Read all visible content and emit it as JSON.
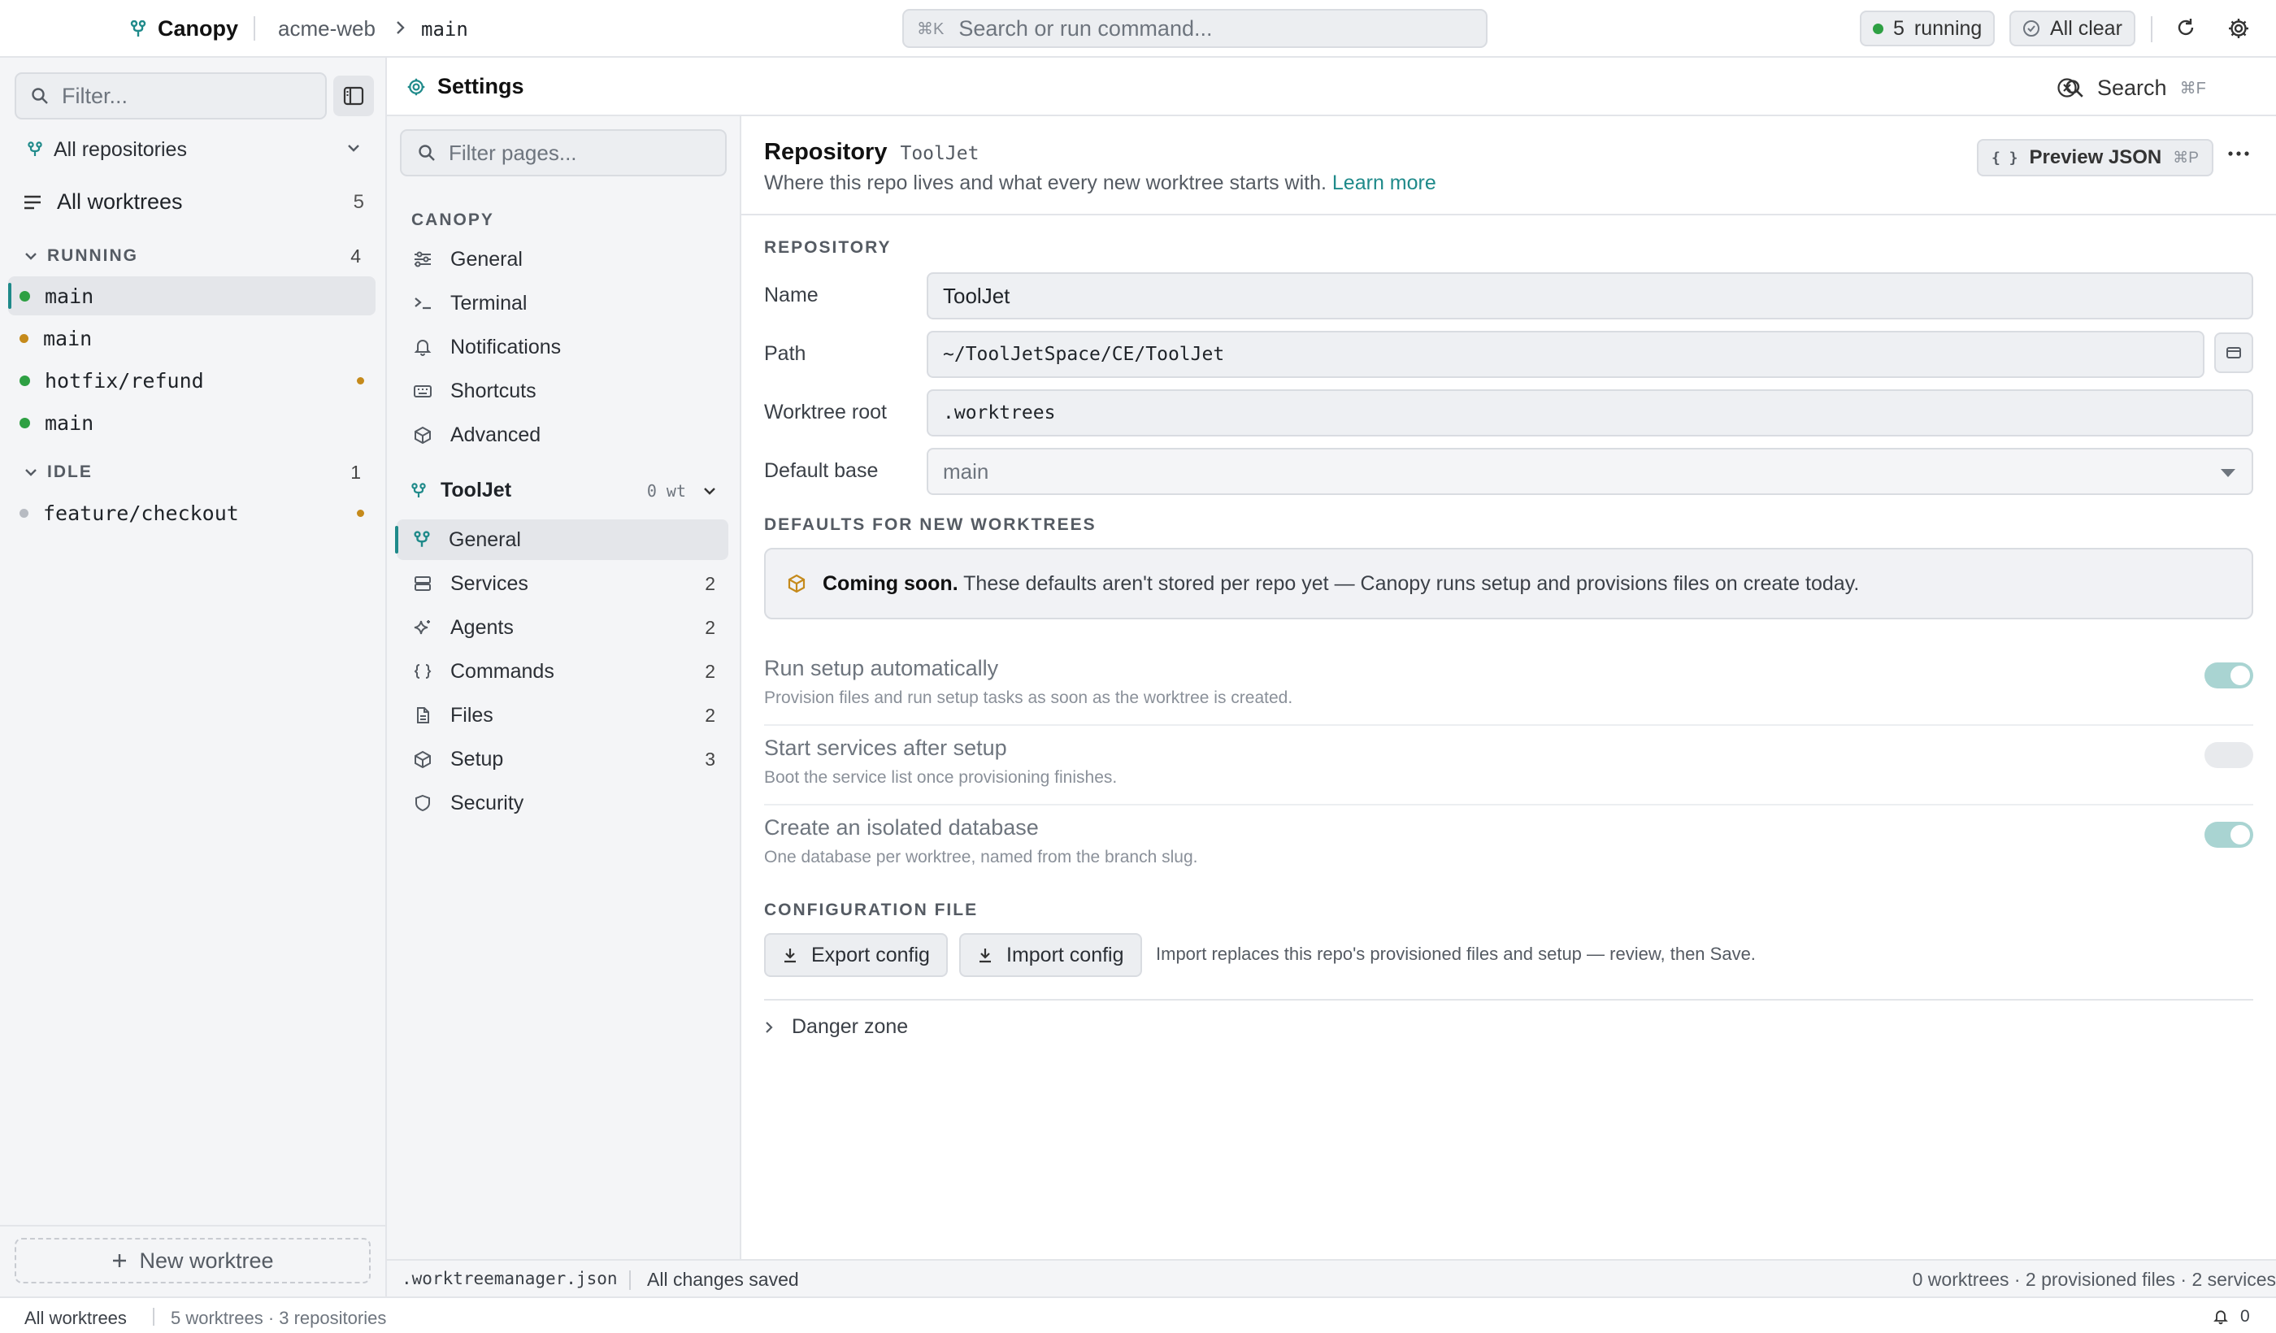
{
  "topbar": {
    "app_name": "Canopy",
    "project": "acme-web",
    "branch": "main",
    "command_shortcut": "⌘K",
    "command_placeholder": "Search or run command...",
    "running_count": "5",
    "running_label": "running",
    "status_label": "All clear"
  },
  "sidebar": {
    "filter_placeholder": "Filter...",
    "repo_selector": "All repositories",
    "all_worktrees_label": "All worktrees",
    "all_worktrees_count": "5",
    "running": {
      "label": "RUNNING",
      "count": "4",
      "items": [
        {
          "name": "main",
          "status": "green"
        },
        {
          "name": "main",
          "status": "orange"
        },
        {
          "name": "hotfix/refund",
          "status": "green"
        },
        {
          "name": "main",
          "status": "green"
        }
      ]
    },
    "idle": {
      "label": "IDLE",
      "count": "1",
      "items": [
        {
          "name": "feature/checkout",
          "status": "gray"
        }
      ]
    },
    "new_worktree_label": "New worktree"
  },
  "settings": {
    "title": "Settings",
    "search_label": "Search",
    "search_shortcut": "⌘F"
  },
  "nav": {
    "filter_placeholder": "Filter pages...",
    "section_canopy": "CANOPY",
    "canopy_items": [
      {
        "label": "General",
        "icon": "sliders-icon"
      },
      {
        "label": "Terminal",
        "icon": "terminal-icon"
      },
      {
        "label": "Notifications",
        "icon": "bell-icon"
      },
      {
        "label": "Shortcuts",
        "icon": "keyboard-icon"
      },
      {
        "label": "Advanced",
        "icon": "cube-icon"
      }
    ],
    "repo_name": "ToolJet",
    "repo_wt": "0 wt",
    "repo_items": [
      {
        "label": "General",
        "count": ""
      },
      {
        "label": "Services",
        "count": "2"
      },
      {
        "label": "Agents",
        "count": "2"
      },
      {
        "label": "Commands",
        "count": "2"
      },
      {
        "label": "Files",
        "count": "2"
      },
      {
        "label": "Setup",
        "count": "3"
      },
      {
        "label": "Security",
        "count": ""
      }
    ]
  },
  "content": {
    "title": "Repository",
    "subtitle": "ToolJet",
    "description": "Where this repo lives and what every new worktree starts with.",
    "learn_more": "Learn more",
    "preview_label": "Preview JSON",
    "preview_shortcut": "⌘P",
    "repository_section": "REPOSITORY",
    "fields": {
      "name_label": "Name",
      "name_value": "ToolJet",
      "path_label": "Path",
      "path_value": "~/ToolJetSpace/CE/ToolJet",
      "root_label": "Worktree root",
      "root_value": ".worktrees",
      "base_label": "Default base",
      "base_value": "main"
    },
    "defaults_section": "DEFAULTS FOR NEW WORKTREES",
    "notice_bold": "Coming soon.",
    "notice_text": "These defaults aren't stored per repo yet — Canopy runs setup and provisions files on create today.",
    "toggles": [
      {
        "title": "Run setup automatically",
        "desc": "Provision files and run setup tasks as soon as the worktree is created.",
        "on": true
      },
      {
        "title": "Start services after setup",
        "desc": "Boot the service list once provisioning finishes.",
        "on": false
      },
      {
        "title": "Create an isolated database",
        "desc": "One database per worktree, named from the branch slug.",
        "on": true
      }
    ],
    "config_section": "CONFIGURATION FILE",
    "export_label": "Export config",
    "import_label": "Import config",
    "import_note": "Import replaces this repo's provisioned files and setup — review, then Save.",
    "danger_label": "Danger zone"
  },
  "footer": {
    "file": ".worktreemanager.json",
    "saved": "All changes saved",
    "stats": "0 worktrees · 2 provisioned files · 2 services"
  },
  "statusbar": {
    "view": "All worktrees",
    "summary": "5 worktrees · 3 repositories",
    "notifications": "0"
  },
  "colors": {
    "accent": "#1f8a8a",
    "running": "#2ea043",
    "warning": "#c58a1b"
  }
}
